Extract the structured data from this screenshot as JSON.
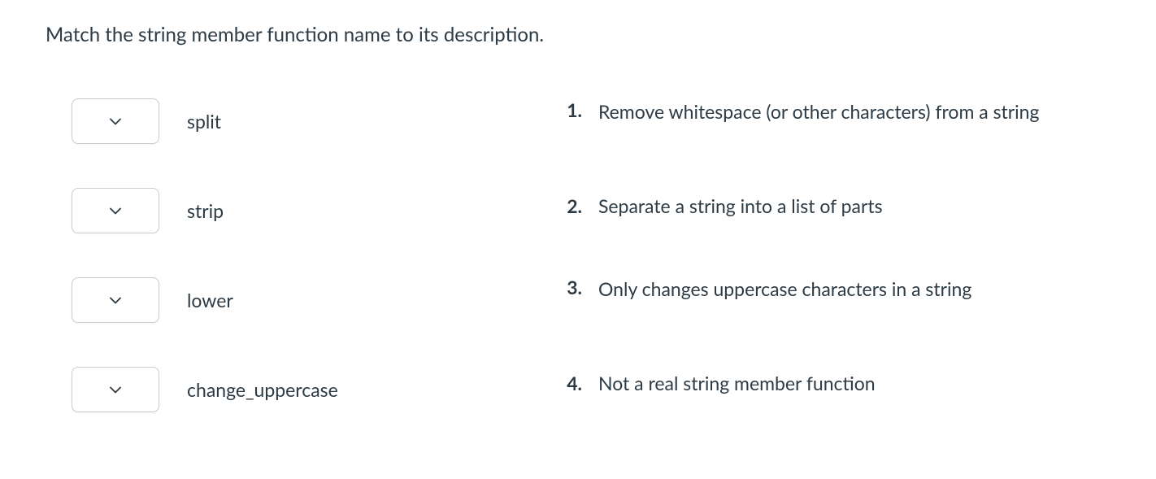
{
  "prompt": "Match the string member function name to its description.",
  "match_items": [
    {
      "label": "split"
    },
    {
      "label": "strip"
    },
    {
      "label": "lower"
    },
    {
      "label": "change_uppercase"
    }
  ],
  "descriptions": [
    {
      "number": "1.",
      "text": "Remove whitespace (or other characters) from a string"
    },
    {
      "number": "2.",
      "text": "Separate a string into a list of parts"
    },
    {
      "number": "3.",
      "text": "Only changes uppercase characters in a string"
    },
    {
      "number": "4.",
      "text": "Not a real string member function"
    }
  ]
}
